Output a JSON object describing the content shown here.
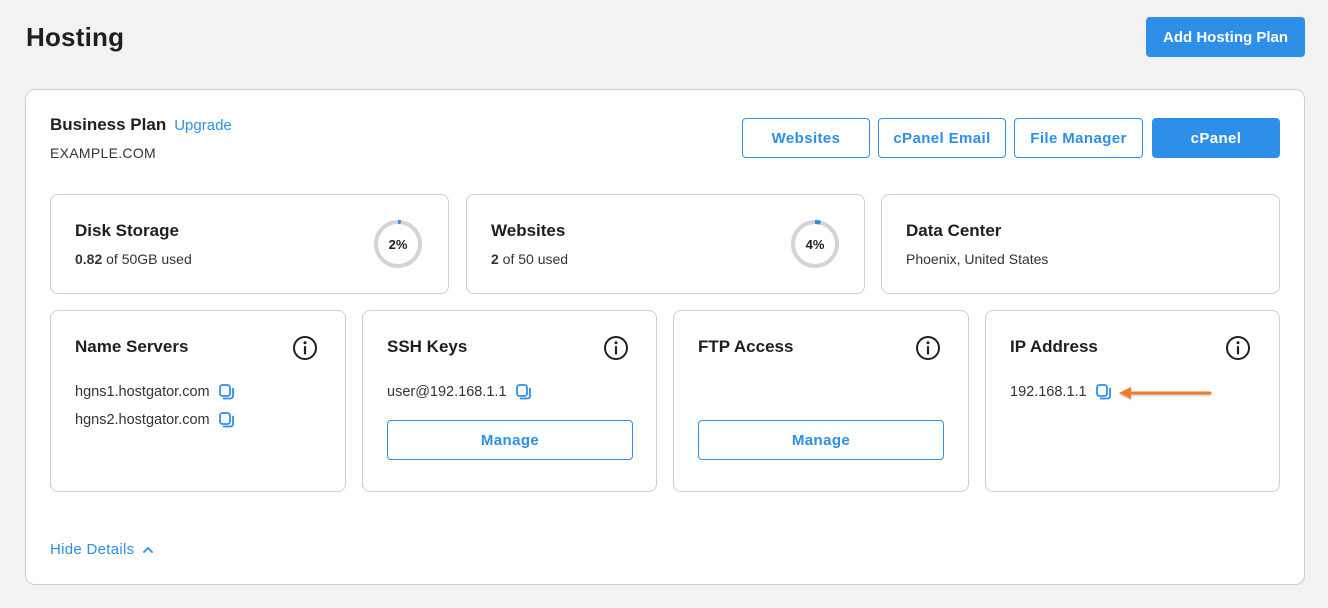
{
  "header": {
    "title": "Hosting",
    "add_button": "Add Hosting Plan"
  },
  "plan": {
    "name": "Business Plan",
    "upgrade_link": "Upgrade",
    "domain": "EXAMPLE.COM",
    "actions": [
      "Websites",
      "cPanel Email",
      "File Manager",
      "cPanel"
    ]
  },
  "stats": {
    "disk": {
      "title": "Disk Storage",
      "used": "0.82",
      "suffix": " of 50GB used",
      "percent_label": "2%",
      "fraction": 0.02
    },
    "websites": {
      "title": "Websites",
      "used": "2",
      "suffix": " of 50 used",
      "percent_label": "4%",
      "fraction": 0.04
    },
    "datacenter": {
      "title": "Data Center",
      "location": "Phoenix, United States"
    }
  },
  "details": {
    "name_servers": {
      "title": "Name Servers",
      "items": [
        "hgns1.hostgator.com",
        "hgns2.hostgator.com"
      ]
    },
    "ssh_keys": {
      "title": "SSH Keys",
      "value": "user@192.168.1.1",
      "button": "Manage"
    },
    "ftp": {
      "title": "FTP Access",
      "button": "Manage"
    },
    "ip": {
      "title": "IP Address",
      "value": "192.168.1.1"
    }
  },
  "footer": {
    "hide_details": "Hide Details"
  },
  "colors": {
    "accent": "#2d8fe8",
    "arrow": "#f07c2a",
    "ring": "#d4d4d4"
  }
}
